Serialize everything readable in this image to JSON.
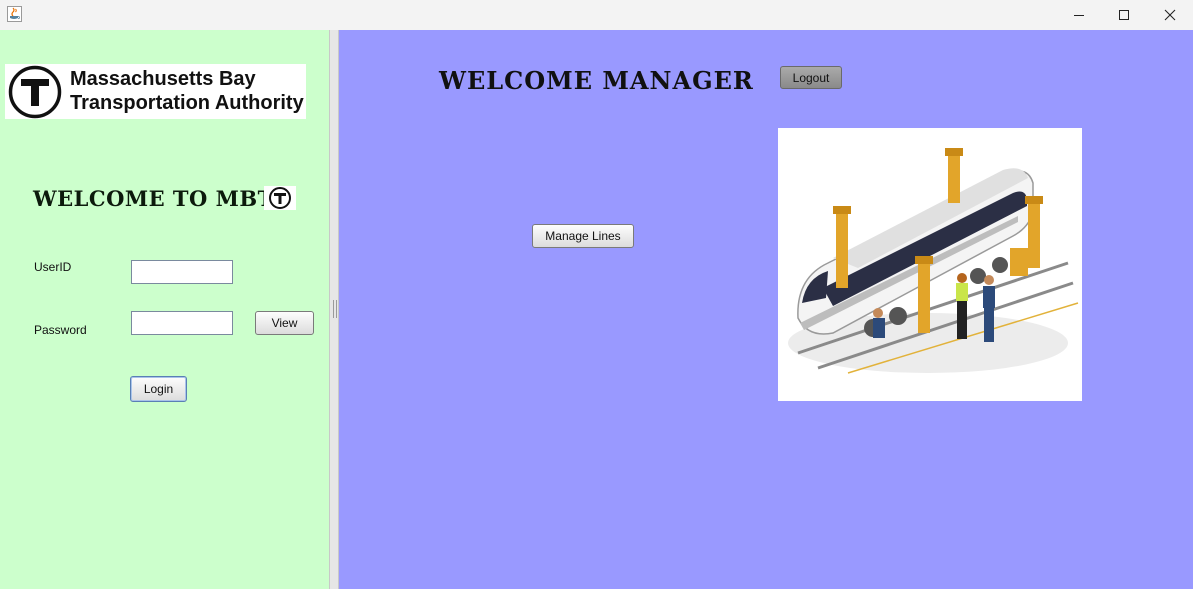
{
  "window": {
    "icon": "java-coffee-cup-icon",
    "controls": [
      "minimize-icon",
      "maximize-icon",
      "close-icon"
    ]
  },
  "login_panel": {
    "logo_line1": "Massachusetts Bay",
    "logo_line2": "Transportation Authority",
    "welcome": "WELCOME TO MBTA",
    "userid_label": "UserID",
    "userid_value": "",
    "password_label": "Password",
    "password_value": "",
    "view_label": "View",
    "login_label": "Login",
    "background": "#ccffcc"
  },
  "manager_panel": {
    "welcome": "WELCOME MANAGER",
    "logout_label": "Logout",
    "manage_lines_label": "Manage Lines",
    "image": "train-maintenance-illustration",
    "background": "#9999ff"
  }
}
